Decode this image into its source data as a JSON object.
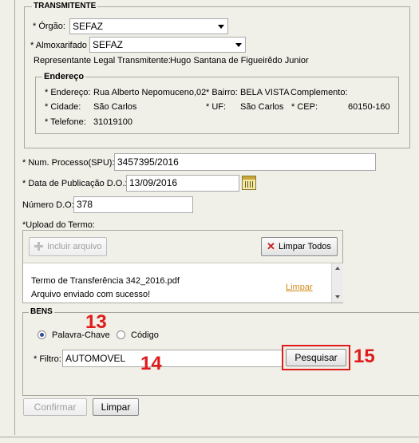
{
  "transmitente": {
    "legend": "TRANSMITENTE",
    "orgao_label": "* Órgão:",
    "orgao_value": "SEFAZ",
    "almox_label": "* Almoxarifado",
    "almox_value": "SEFAZ",
    "rep_label": "Representante Legal Transmitente:",
    "rep_value": "Hugo Santana de Figueirêdo Junior",
    "endereco": {
      "legend": "Endereço",
      "endereco_label": "* Endereço:",
      "endereco_value": "Rua Alberto Nepomuceno,02",
      "bairro_label": "* Bairro:",
      "bairro_value": "BELA VISTA",
      "complemento_label": "Complemento:",
      "cidade_label": "* Cidade:",
      "cidade_value": "São Carlos",
      "uf_label": "* UF:",
      "uf_value": "São Carlos",
      "cep_label": "* CEP:",
      "cep_value": "60150-160",
      "telefone_label": "* Telefone:",
      "telefone_value": "31019100"
    }
  },
  "processo": {
    "num_label": "* Num. Processo(SPU):",
    "num_value": "3457395/2016",
    "data_label": "* Data de Publicação D.O.:",
    "data_value": "13/09/2016",
    "numero_do_label": "Número D.O:",
    "numero_do_value": "378"
  },
  "upload": {
    "label": "*Upload do Termo:",
    "incluir_label": "Incluir arquivo",
    "limpar_todos_label": "Limpar Todos",
    "file_name": "Termo de Transferência 342_2016.pdf",
    "file_status": "Arquivo enviado com sucesso!",
    "file_limpar": "Limpar"
  },
  "bens": {
    "legend": "BENS",
    "radio_palavra": "Palavra-Chave",
    "radio_codigo": "Código",
    "filtro_label": "* Filtro:",
    "filtro_value": "AUTOMOVEL",
    "pesquisar_label": "Pesquisar"
  },
  "annotations": {
    "a13": "13",
    "a14": "14",
    "a15": "15"
  },
  "footer": {
    "confirmar_label": "Confirmar",
    "limpar_label": "Limpar"
  },
  "colors": {
    "annotation_red": "#e01b1b",
    "link_orange": "#d08a1a"
  }
}
